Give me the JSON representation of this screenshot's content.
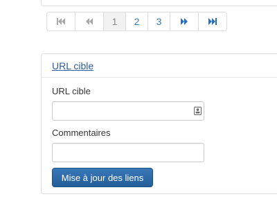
{
  "pagination": {
    "first_icon": "first-page-icon",
    "prev_icon": "previous-page-icon",
    "pages": [
      "1",
      "2",
      "3"
    ],
    "current_page": "1",
    "next_icon": "next-page-icon",
    "last_icon": "last-page-icon",
    "colors": {
      "enabled": "#2a6ebb",
      "disabled": "#a8a8a8",
      "active_bg": "#f2f2f2"
    }
  },
  "form_panel": {
    "title": "URL cible",
    "url_field": {
      "label": "URL cible",
      "value": "",
      "placeholder": "",
      "icon": "contact-card-icon"
    },
    "comments_field": {
      "label": "Commentaires",
      "value": "",
      "placeholder": ""
    },
    "submit_label": "Mise à jour des liens",
    "colors": {
      "link": "#2a5d9f",
      "button": "#2f6aa8"
    }
  }
}
